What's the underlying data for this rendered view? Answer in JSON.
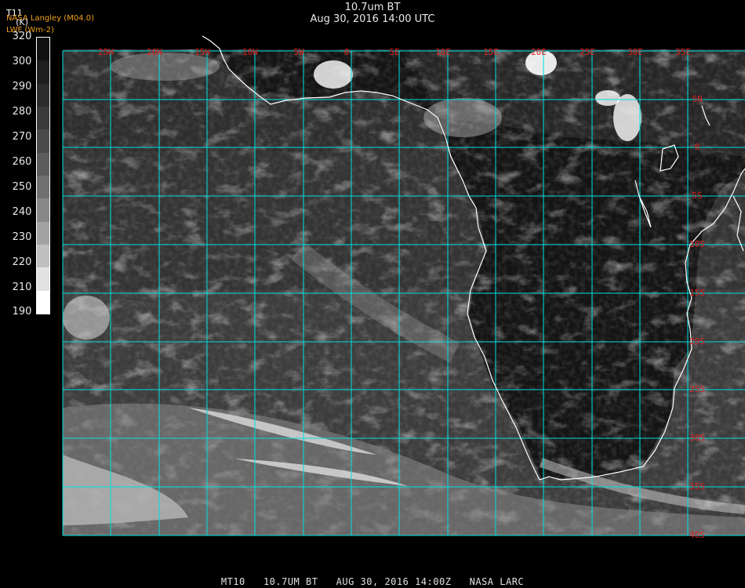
{
  "header": {
    "title": "10.7um BT",
    "datetime": "Aug 30, 2016 14:00 UTC",
    "variable": "T11",
    "source": "NASA Langley (M04.0)",
    "units": "LWF (Wm-2)"
  },
  "legend": {
    "unit_label": "(K)",
    "ticks": [
      "320",
      "300",
      "290",
      "280",
      "270",
      "260",
      "250",
      "240",
      "230",
      "220",
      "210",
      "190"
    ],
    "colors": [
      "#101010",
      "#1e1e1e",
      "#2c2c2c",
      "#3a3a3a",
      "#4a4a4a",
      "#5c5c5c",
      "#707070",
      "#888888",
      "#a2a2a2",
      "#c0c0c0",
      "#e2e2e2",
      "#ffffff"
    ]
  },
  "map": {
    "grid_color": "#00e0e0",
    "label_color": "#e02020",
    "coast_color": "#ffffff",
    "lon_labels": [
      "25W",
      "20W",
      "15W",
      "10W",
      "5W",
      "0",
      "5E",
      "10E",
      "15E",
      "20E",
      "25E",
      "30E",
      "35E"
    ],
    "lat_labels": [
      "5N",
      "0",
      "5S",
      "10S",
      "15S",
      "20S",
      "25S",
      "30S",
      "35S",
      "40S"
    ]
  },
  "footer": {
    "sat": "MT10",
    "channel": "10.7UM BT",
    "date": "AUG 30, 2016 14:00Z",
    "agency": "NASA LARC"
  }
}
